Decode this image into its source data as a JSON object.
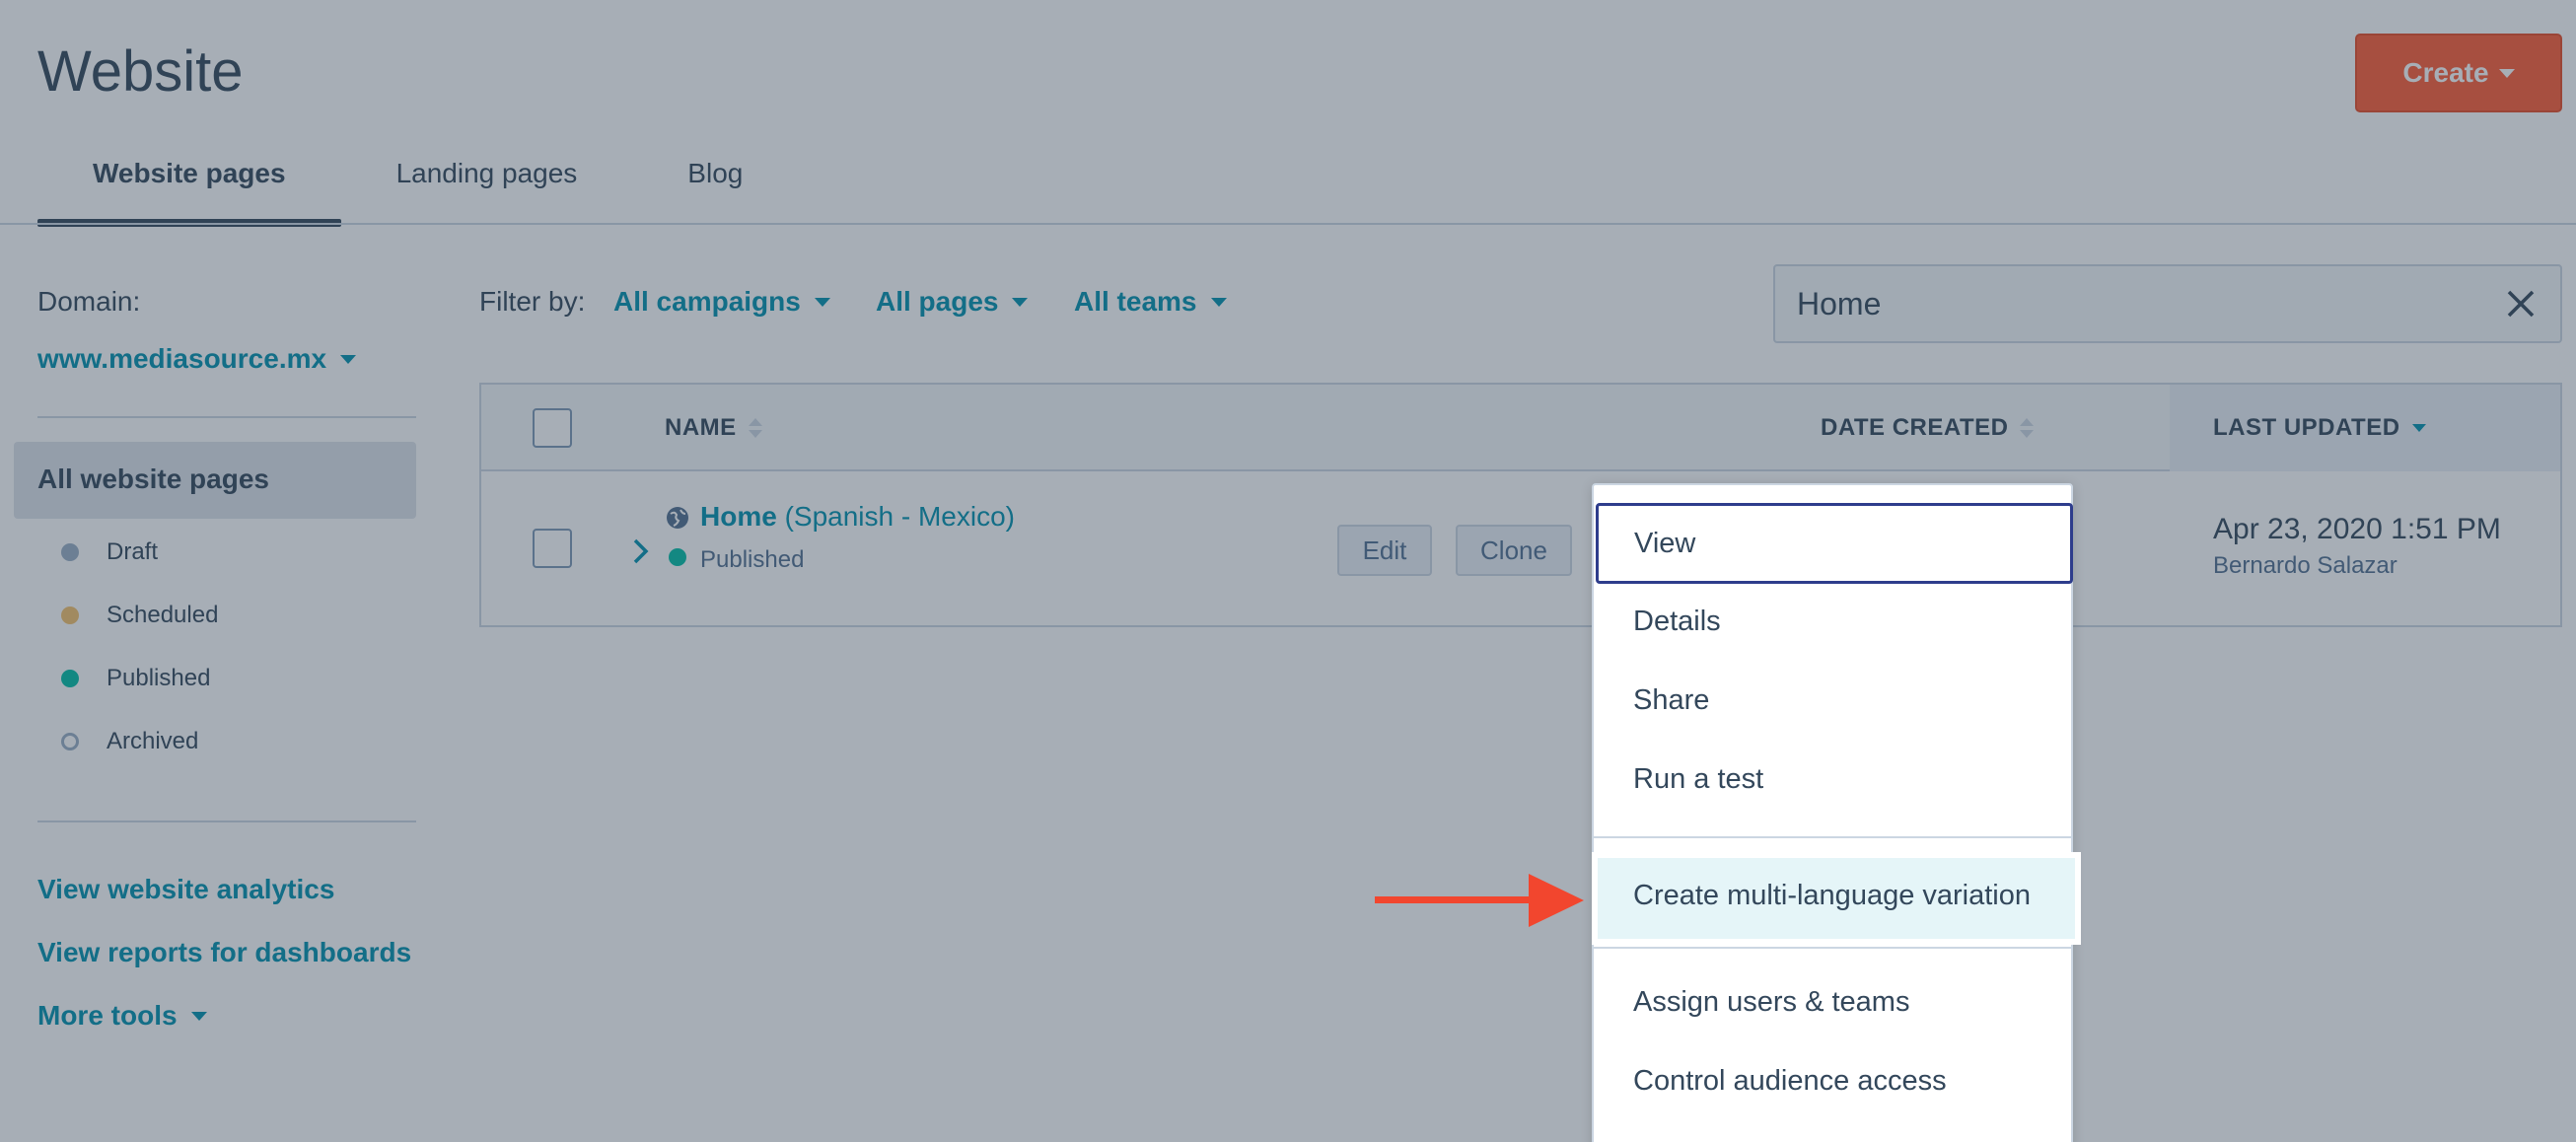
{
  "header": {
    "title": "Website",
    "create_label": "Create"
  },
  "tabs": [
    {
      "label": "Website pages",
      "active": true
    },
    {
      "label": "Landing pages",
      "active": false
    },
    {
      "label": "Blog",
      "active": false
    }
  ],
  "sidebar": {
    "domain_label": "Domain:",
    "domain_value": "www.mediasource.mx",
    "all_pages_label": "All website pages",
    "statuses": [
      {
        "label": "Draft",
        "color": "#99afc4"
      },
      {
        "label": "Scheduled",
        "color": "#f5c26b"
      },
      {
        "label": "Published",
        "color": "#00bda5"
      },
      {
        "label": "Archived",
        "color": "#ffffff"
      }
    ],
    "links": {
      "analytics": "View website analytics",
      "reports": "View reports for dashboards",
      "more_tools": "More tools"
    }
  },
  "filters": {
    "label": "Filter by:",
    "campaigns": "All campaigns",
    "pages": "All pages",
    "teams": "All teams"
  },
  "search": {
    "value": "Home"
  },
  "table": {
    "columns": {
      "name": "NAME",
      "date_created": "DATE CREATED",
      "last_updated": "LAST UPDATED"
    },
    "rows": [
      {
        "name": "Home",
        "language": "(Spanish - Mexico)",
        "status": "Published",
        "edit_label": "Edit",
        "clone_label": "Clone",
        "last_updated": "Apr 23, 2020 1:51 PM",
        "updated_by": "Bernardo Salazar"
      }
    ]
  },
  "menu": {
    "items": [
      "View",
      "Details",
      "Share",
      "Run a test"
    ],
    "highlighted": "Create multi-language variation",
    "items_after": [
      "Assign users & teams",
      "Control audience access"
    ]
  },
  "colors": {
    "accent": "#0091ae",
    "brand": "#ff5c35",
    "arrow": "#f2462e"
  }
}
